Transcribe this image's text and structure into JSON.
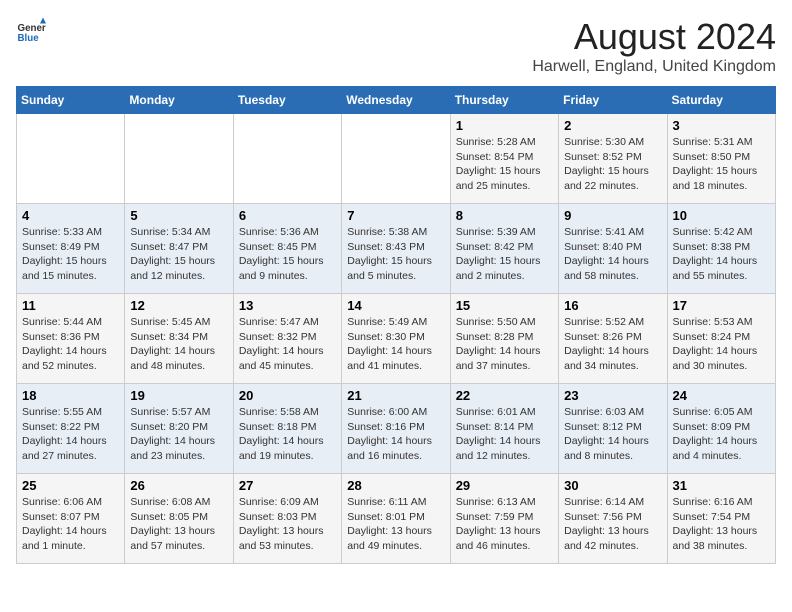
{
  "header": {
    "logo_general": "General",
    "logo_blue": "Blue",
    "main_title": "August 2024",
    "subtitle": "Harwell, England, United Kingdom"
  },
  "days_of_week": [
    "Sunday",
    "Monday",
    "Tuesday",
    "Wednesday",
    "Thursday",
    "Friday",
    "Saturday"
  ],
  "weeks": [
    [
      {
        "day": "",
        "info": ""
      },
      {
        "day": "",
        "info": ""
      },
      {
        "day": "",
        "info": ""
      },
      {
        "day": "",
        "info": ""
      },
      {
        "day": "1",
        "info": "Sunrise: 5:28 AM\nSunset: 8:54 PM\nDaylight: 15 hours\nand 25 minutes."
      },
      {
        "day": "2",
        "info": "Sunrise: 5:30 AM\nSunset: 8:52 PM\nDaylight: 15 hours\nand 22 minutes."
      },
      {
        "day": "3",
        "info": "Sunrise: 5:31 AM\nSunset: 8:50 PM\nDaylight: 15 hours\nand 18 minutes."
      }
    ],
    [
      {
        "day": "4",
        "info": "Sunrise: 5:33 AM\nSunset: 8:49 PM\nDaylight: 15 hours\nand 15 minutes."
      },
      {
        "day": "5",
        "info": "Sunrise: 5:34 AM\nSunset: 8:47 PM\nDaylight: 15 hours\nand 12 minutes."
      },
      {
        "day": "6",
        "info": "Sunrise: 5:36 AM\nSunset: 8:45 PM\nDaylight: 15 hours\nand 9 minutes."
      },
      {
        "day": "7",
        "info": "Sunrise: 5:38 AM\nSunset: 8:43 PM\nDaylight: 15 hours\nand 5 minutes."
      },
      {
        "day": "8",
        "info": "Sunrise: 5:39 AM\nSunset: 8:42 PM\nDaylight: 15 hours\nand 2 minutes."
      },
      {
        "day": "9",
        "info": "Sunrise: 5:41 AM\nSunset: 8:40 PM\nDaylight: 14 hours\nand 58 minutes."
      },
      {
        "day": "10",
        "info": "Sunrise: 5:42 AM\nSunset: 8:38 PM\nDaylight: 14 hours\nand 55 minutes."
      }
    ],
    [
      {
        "day": "11",
        "info": "Sunrise: 5:44 AM\nSunset: 8:36 PM\nDaylight: 14 hours\nand 52 minutes."
      },
      {
        "day": "12",
        "info": "Sunrise: 5:45 AM\nSunset: 8:34 PM\nDaylight: 14 hours\nand 48 minutes."
      },
      {
        "day": "13",
        "info": "Sunrise: 5:47 AM\nSunset: 8:32 PM\nDaylight: 14 hours\nand 45 minutes."
      },
      {
        "day": "14",
        "info": "Sunrise: 5:49 AM\nSunset: 8:30 PM\nDaylight: 14 hours\nand 41 minutes."
      },
      {
        "day": "15",
        "info": "Sunrise: 5:50 AM\nSunset: 8:28 PM\nDaylight: 14 hours\nand 37 minutes."
      },
      {
        "day": "16",
        "info": "Sunrise: 5:52 AM\nSunset: 8:26 PM\nDaylight: 14 hours\nand 34 minutes."
      },
      {
        "day": "17",
        "info": "Sunrise: 5:53 AM\nSunset: 8:24 PM\nDaylight: 14 hours\nand 30 minutes."
      }
    ],
    [
      {
        "day": "18",
        "info": "Sunrise: 5:55 AM\nSunset: 8:22 PM\nDaylight: 14 hours\nand 27 minutes."
      },
      {
        "day": "19",
        "info": "Sunrise: 5:57 AM\nSunset: 8:20 PM\nDaylight: 14 hours\nand 23 minutes."
      },
      {
        "day": "20",
        "info": "Sunrise: 5:58 AM\nSunset: 8:18 PM\nDaylight: 14 hours\nand 19 minutes."
      },
      {
        "day": "21",
        "info": "Sunrise: 6:00 AM\nSunset: 8:16 PM\nDaylight: 14 hours\nand 16 minutes."
      },
      {
        "day": "22",
        "info": "Sunrise: 6:01 AM\nSunset: 8:14 PM\nDaylight: 14 hours\nand 12 minutes."
      },
      {
        "day": "23",
        "info": "Sunrise: 6:03 AM\nSunset: 8:12 PM\nDaylight: 14 hours\nand 8 minutes."
      },
      {
        "day": "24",
        "info": "Sunrise: 6:05 AM\nSunset: 8:09 PM\nDaylight: 14 hours\nand 4 minutes."
      }
    ],
    [
      {
        "day": "25",
        "info": "Sunrise: 6:06 AM\nSunset: 8:07 PM\nDaylight: 14 hours\nand 1 minute."
      },
      {
        "day": "26",
        "info": "Sunrise: 6:08 AM\nSunset: 8:05 PM\nDaylight: 13 hours\nand 57 minutes."
      },
      {
        "day": "27",
        "info": "Sunrise: 6:09 AM\nSunset: 8:03 PM\nDaylight: 13 hours\nand 53 minutes."
      },
      {
        "day": "28",
        "info": "Sunrise: 6:11 AM\nSunset: 8:01 PM\nDaylight: 13 hours\nand 49 minutes."
      },
      {
        "day": "29",
        "info": "Sunrise: 6:13 AM\nSunset: 7:59 PM\nDaylight: 13 hours\nand 46 minutes."
      },
      {
        "day": "30",
        "info": "Sunrise: 6:14 AM\nSunset: 7:56 PM\nDaylight: 13 hours\nand 42 minutes."
      },
      {
        "day": "31",
        "info": "Sunrise: 6:16 AM\nSunset: 7:54 PM\nDaylight: 13 hours\nand 38 minutes."
      }
    ]
  ]
}
